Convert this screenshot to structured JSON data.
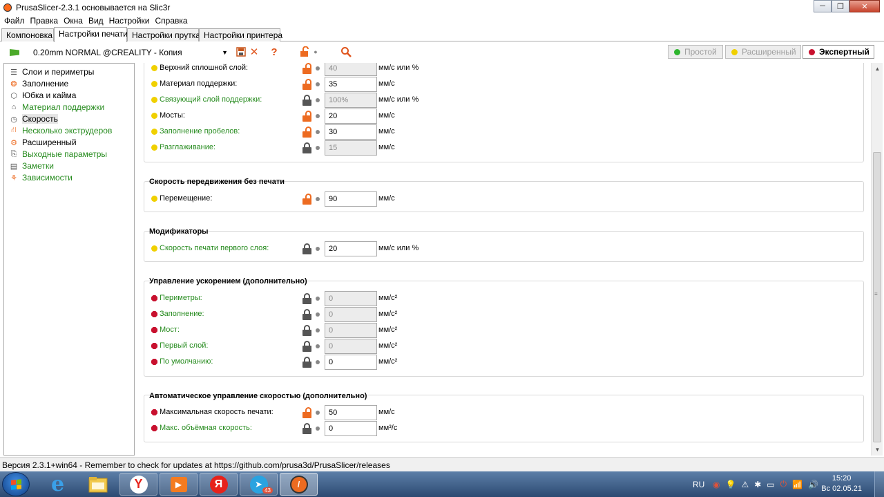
{
  "window": {
    "title": "PrusaSlicer-2.3.1 основывается на Slic3r",
    "minimize": "─",
    "restore": "❐",
    "close": "✕"
  },
  "menu": [
    "Файл",
    "Правка",
    "Окна",
    "Вид",
    "Настройки",
    "Справка"
  ],
  "tabs": [
    "Компоновка",
    "Настройки печати",
    "Настройки прутка",
    "Настройки принтера"
  ],
  "active_tab": "Настройки печати",
  "toolbar": {
    "preset": "0.20mm NORMAL @CREALITY - Копия",
    "modes": [
      {
        "label": "Простой",
        "color": "#2db52d",
        "active": false
      },
      {
        "label": "Расширенный",
        "color": "#f0d000",
        "active": false
      },
      {
        "label": "Экспертный",
        "color": "#c8102e",
        "active": true
      }
    ]
  },
  "sidebar": {
    "items": [
      {
        "label": "Слои и периметры",
        "icon": "layers-icon",
        "green": false
      },
      {
        "label": "Заполнение",
        "icon": "infill-icon",
        "green": false
      },
      {
        "label": "Юбка и кайма",
        "icon": "skirt-icon",
        "green": false
      },
      {
        "label": "Материал поддержки",
        "icon": "support-icon",
        "green": true
      },
      {
        "label": "Скорость",
        "icon": "speed-icon",
        "green": false,
        "selected": true
      },
      {
        "label": "Несколько экструдеров",
        "icon": "extruders-icon",
        "green": true
      },
      {
        "label": "Расширенный",
        "icon": "wrench-icon",
        "green": false
      },
      {
        "label": "Выходные параметры",
        "icon": "output-icon",
        "green": true
      },
      {
        "label": "Заметки",
        "icon": "notes-icon",
        "green": true
      },
      {
        "label": "Зависимости",
        "icon": "dependencies-icon",
        "green": true
      }
    ]
  },
  "groups": [
    {
      "title": "",
      "rows": [
        {
          "label": "Верхний сплошной слой:",
          "green": false,
          "bullet": "yellow",
          "lock": "open",
          "value": "40",
          "disabled": true,
          "unit": "мм/с или %"
        },
        {
          "label": "Материал поддержки:",
          "green": false,
          "bullet": "yellow",
          "lock": "open",
          "value": "35",
          "disabled": false,
          "unit": "мм/с"
        },
        {
          "label": "Связующий слой поддержки:",
          "green": true,
          "bullet": "yellow",
          "lock": "closed",
          "value": "100%",
          "disabled": true,
          "unit": "мм/с или %"
        },
        {
          "label": "Мосты:",
          "green": false,
          "bullet": "yellow",
          "lock": "open",
          "value": "20",
          "disabled": false,
          "unit": "мм/с"
        },
        {
          "label": "Заполнение пробелов:",
          "green": true,
          "bullet": "yellow",
          "lock": "open",
          "value": "30",
          "disabled": false,
          "unit": "мм/с"
        },
        {
          "label": "Разглаживание:",
          "green": true,
          "bullet": "yellow",
          "lock": "closed",
          "value": "15",
          "disabled": true,
          "unit": "мм/с"
        }
      ]
    },
    {
      "title": "Скорость передвижения без печати",
      "rows": [
        {
          "label": "Перемещение:",
          "green": false,
          "bullet": "yellow",
          "lock": "open",
          "value": "90",
          "disabled": false,
          "unit": "мм/с"
        }
      ]
    },
    {
      "title": "Модификаторы",
      "rows": [
        {
          "label": "Скорость печати первого слоя:",
          "green": true,
          "bullet": "yellow",
          "lock": "closed",
          "value": "20",
          "disabled": false,
          "unit": "мм/с или %"
        }
      ]
    },
    {
      "title": "Управление ускорением (дополнительно)",
      "rows": [
        {
          "label": "Периметры:",
          "green": true,
          "bullet": "red",
          "lock": "closed",
          "value": "0",
          "disabled": true,
          "unit": "мм/с²"
        },
        {
          "label": "Заполнение:",
          "green": true,
          "bullet": "red",
          "lock": "closed",
          "value": "0",
          "disabled": true,
          "unit": "мм/с²"
        },
        {
          "label": "Мост:",
          "green": true,
          "bullet": "red",
          "lock": "closed",
          "value": "0",
          "disabled": true,
          "unit": "мм/с²"
        },
        {
          "label": "Первый слой:",
          "green": true,
          "bullet": "red",
          "lock": "closed",
          "value": "0",
          "disabled": true,
          "unit": "мм/с²"
        },
        {
          "label": "По умолчанию:",
          "green": true,
          "bullet": "red",
          "lock": "closed",
          "value": "0",
          "disabled": false,
          "unit": "мм/с²"
        }
      ]
    },
    {
      "title": "Автоматическое управление скоростью (дополнительно)",
      "rows": [
        {
          "label": "Максимальная скорость печати:",
          "green": false,
          "bullet": "red",
          "lock": "open",
          "value": "50",
          "disabled": false,
          "unit": "мм/с"
        },
        {
          "label": "Макс. объёмная скорость:",
          "green": true,
          "bullet": "red",
          "lock": "closed",
          "value": "0",
          "disabled": false,
          "unit": "мм³/с"
        }
      ]
    }
  ],
  "status": "Версия 2.3.1+win64 - Remember to check for updates at https://github.com/prusa3d/PrusaSlicer/releases",
  "taskbar": {
    "language": "RU",
    "time": "15:20",
    "date": "Вс 02.05.21",
    "telegram_badge": "43"
  }
}
